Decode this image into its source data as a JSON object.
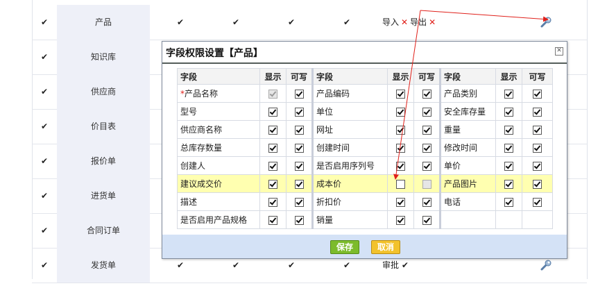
{
  "background_rows": [
    {
      "name": "产品",
      "check_left": "✔",
      "checks": [
        "✔",
        "✔",
        "✔",
        "✔"
      ],
      "extra_type": "import_export",
      "import_label": "导入",
      "export_label": "导出",
      "has_tool": true
    },
    {
      "name": "知识库",
      "check_left": "✔",
      "checks": [],
      "extra_type": "none",
      "has_tool": false
    },
    {
      "name": "供应商",
      "check_left": "✔",
      "checks": [],
      "extra_type": "none",
      "has_tool": false
    },
    {
      "name": "价目表",
      "check_left": "✔",
      "checks": [],
      "extra_type": "none",
      "has_tool": false
    },
    {
      "name": "报价单",
      "check_left": "✔",
      "checks": [],
      "extra_type": "none",
      "has_tool": false
    },
    {
      "name": "进货单",
      "check_left": "✔",
      "checks": [],
      "extra_type": "none",
      "has_tool": false
    },
    {
      "name": "合同订单",
      "check_left": "✔",
      "checks": [],
      "extra_type": "none",
      "has_tool": false
    },
    {
      "name": "发货单",
      "check_left": "✔",
      "checks": [
        "✔",
        "✔",
        "✔",
        "✔"
      ],
      "extra_type": "approve",
      "approve_label": "审批",
      "approve_mark": "✔",
      "has_tool": true
    }
  ],
  "dialog": {
    "title": "字段权限设置【产品】",
    "close_glyph": "✕",
    "headers": {
      "field": "字段",
      "show": "显示",
      "write": "可写"
    },
    "rows": [
      {
        "highlight": false,
        "cells": [
          {
            "label": "产品名称",
            "required": true,
            "required_mark": "*",
            "show": true,
            "write": true,
            "show_disabled": true,
            "write_disabled": false
          },
          {
            "label": "产品编码",
            "required": false,
            "show": true,
            "write": true,
            "show_disabled": false,
            "write_disabled": false
          },
          {
            "label": "产品类别",
            "required": false,
            "show": true,
            "write": true,
            "show_disabled": false,
            "write_disabled": false
          }
        ]
      },
      {
        "highlight": false,
        "cells": [
          {
            "label": "型号",
            "required": false,
            "show": true,
            "write": true,
            "show_disabled": false,
            "write_disabled": false
          },
          {
            "label": "单位",
            "required": false,
            "show": true,
            "write": true,
            "show_disabled": false,
            "write_disabled": false
          },
          {
            "label": "安全库存量",
            "required": false,
            "show": true,
            "write": true,
            "show_disabled": false,
            "write_disabled": false
          }
        ]
      },
      {
        "highlight": false,
        "cells": [
          {
            "label": "供应商名称",
            "required": false,
            "show": true,
            "write": true,
            "show_disabled": false,
            "write_disabled": false
          },
          {
            "label": "网址",
            "required": false,
            "show": true,
            "write": true,
            "show_disabled": false,
            "write_disabled": false
          },
          {
            "label": "重量",
            "required": false,
            "show": true,
            "write": true,
            "show_disabled": false,
            "write_disabled": false
          }
        ]
      },
      {
        "highlight": false,
        "cells": [
          {
            "label": "总库存数量",
            "required": false,
            "show": true,
            "write": true,
            "show_disabled": false,
            "write_disabled": false
          },
          {
            "label": "创建时间",
            "required": false,
            "show": true,
            "write": true,
            "show_disabled": false,
            "write_disabled": false
          },
          {
            "label": "修改时间",
            "required": false,
            "show": true,
            "write": true,
            "show_disabled": false,
            "write_disabled": false
          }
        ]
      },
      {
        "highlight": false,
        "cells": [
          {
            "label": "创建人",
            "required": false,
            "show": true,
            "write": true,
            "show_disabled": false,
            "write_disabled": false
          },
          {
            "label": "是否启用序列号",
            "required": false,
            "show": true,
            "write": true,
            "show_disabled": false,
            "write_disabled": false
          },
          {
            "label": "单价",
            "required": false,
            "show": true,
            "write": true,
            "show_disabled": false,
            "write_disabled": false
          }
        ]
      },
      {
        "highlight": true,
        "cells": [
          {
            "label": "建议成交价",
            "required": false,
            "show": true,
            "write": true,
            "show_disabled": false,
            "write_disabled": false
          },
          {
            "label": "成本价",
            "required": false,
            "show": false,
            "write": false,
            "show_disabled": false,
            "write_disabled": true
          },
          {
            "label": "产品图片",
            "required": false,
            "show": true,
            "write": true,
            "show_disabled": false,
            "write_disabled": false
          }
        ]
      },
      {
        "highlight": false,
        "cells": [
          {
            "label": "描述",
            "required": false,
            "show": true,
            "write": true,
            "show_disabled": false,
            "write_disabled": false
          },
          {
            "label": "折扣价",
            "required": false,
            "show": true,
            "write": true,
            "show_disabled": false,
            "write_disabled": false
          },
          {
            "label": "电话",
            "required": false,
            "show": true,
            "write": true,
            "show_disabled": false,
            "write_disabled": false
          }
        ]
      },
      {
        "highlight": false,
        "cells": [
          {
            "label": "是否启用产品规格",
            "required": false,
            "show": true,
            "write": true,
            "show_disabled": false,
            "write_disabled": false
          },
          {
            "label": "销量",
            "required": false,
            "show": true,
            "write": true,
            "show_disabled": false,
            "write_disabled": false
          },
          null
        ]
      }
    ],
    "save_label": "保存",
    "cancel_label": "取消"
  },
  "colors": {
    "highlight_row": "#ffffb0",
    "footer_bg": "#d4e2f6",
    "save_button": "#7cbb2c",
    "cancel_button": "#f2c22c",
    "annotation_arrow": "#e0201a",
    "name_column_bg": "#eef0f8"
  },
  "icons": {
    "tool": "wrench-icon",
    "delete": "x-mark-icon",
    "close": "close-icon"
  }
}
